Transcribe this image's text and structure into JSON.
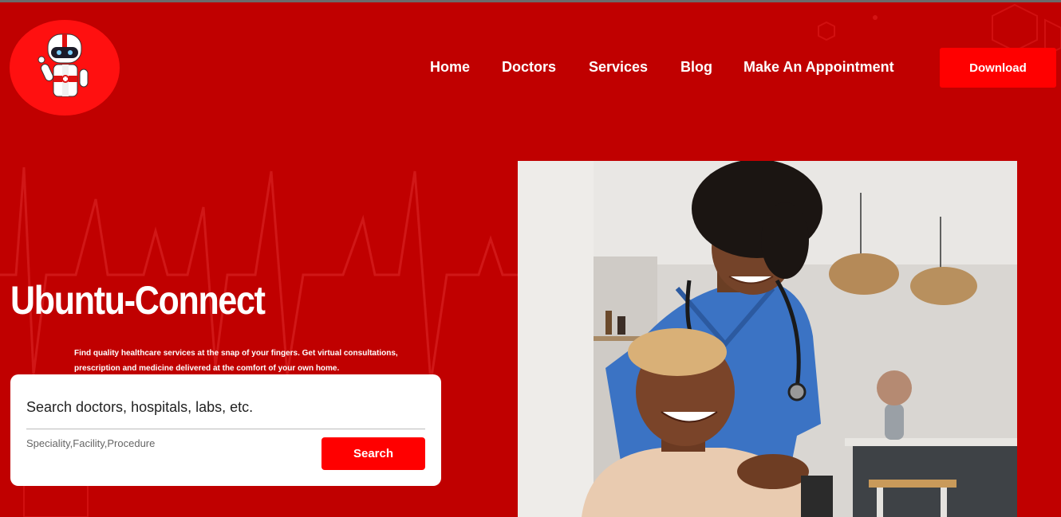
{
  "brand": {
    "logo_icon": "robot-doctor-icon"
  },
  "nav": {
    "items": [
      {
        "label": "Home"
      },
      {
        "label": "Doctors"
      },
      {
        "label": "Services"
      },
      {
        "label": "Blog"
      },
      {
        "label": "Make An Appointment"
      }
    ],
    "download_label": "Download"
  },
  "hero": {
    "title": "Ubuntu-Connect",
    "description_line1": "Find quality healthcare services at the snap of your fingers. Get virtual consultations,",
    "description_line2": "prescription and medicine delivered at the comfort of your own home.",
    "image_alt": "Smiling nurse in blue scrubs with stethoscope standing behind a smiling elderly woman"
  },
  "search": {
    "placeholder": "Search doctors, hospitals, labs, etc.",
    "value": "",
    "hint": "Speciality,Facility,Procedure",
    "button_label": "Search"
  },
  "colors": {
    "background": "#c00000",
    "accent": "#ff0000",
    "card": "#ffffff"
  }
}
